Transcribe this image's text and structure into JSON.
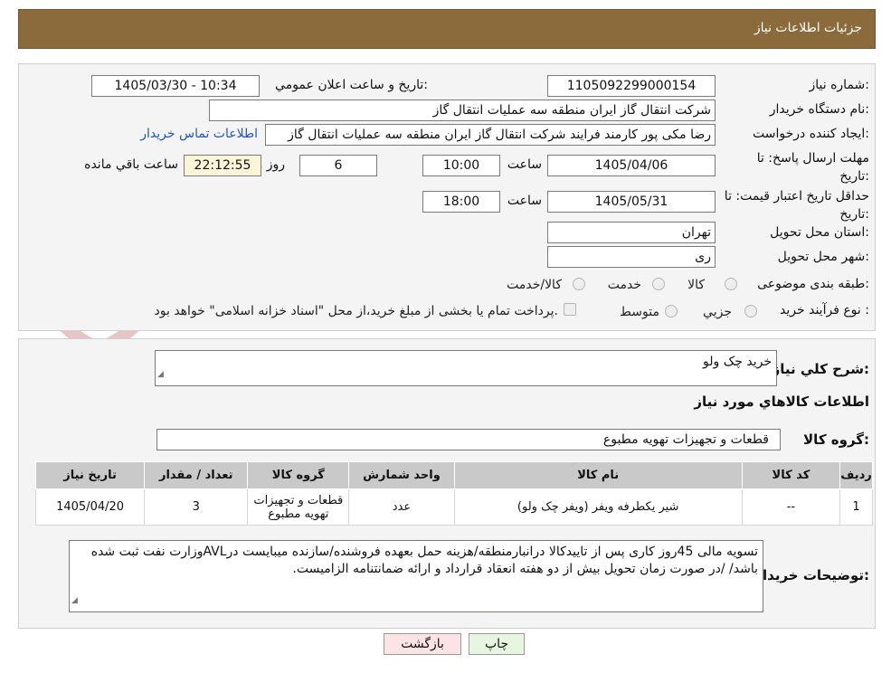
{
  "header": {
    "title": "جزئیات اطلاعات نیاز"
  },
  "watermark": {
    "text": "AriaTender.neT"
  },
  "form": {
    "need_number": {
      "label": "شماره نیاز:",
      "value": "1105092299000154"
    },
    "announce_datetime": {
      "label": "تاریخ و ساعت اعلان عمومي:",
      "value": "1405/03/30 - 10:34"
    },
    "buyer_org": {
      "label": "نام دستگاه خریدار:",
      "value": "شرکت انتقال گاز ایران منطقه سه عملیات انتقال گاز"
    },
    "creator": {
      "label": "ایجاد کننده درخواست:",
      "value": "رضا مکی پور کارمند فرایند شرکت انتقال گاز ایران منطقه سه عملیات انتقال گاز",
      "contact_link": "اطلاعات تماس خریدار"
    },
    "deadline": {
      "label": "مهلت ارسال پاسخ: تا تاریخ:",
      "date": "1405/04/06",
      "time_label": "ساعت",
      "time": "10:00",
      "days": "6",
      "days_label": "روز و",
      "remaining": "22:12:55",
      "remaining_label": "ساعت باقي مانده"
    },
    "price_validity": {
      "label": "حداقل تاریخ اعتبار قیمت: تا تاریخ:",
      "date": "1405/05/31",
      "time_label": "ساعت",
      "time": "18:00"
    },
    "province": {
      "label": "استان محل تحویل:",
      "value": "تهران"
    },
    "city": {
      "label": "شهر محل تحویل:",
      "value": "ری"
    },
    "category": {
      "label": "طبقه بندی موضوعی:",
      "options": [
        "کالا",
        "خدمت",
        "کالا/خدمت"
      ]
    },
    "process": {
      "label": "نوع فرآیند خرید :",
      "options": [
        "جزيي",
        "متوسط"
      ],
      "payment_note": "پرداخت تمام یا بخشی از مبلغ خرید،از محل \"اسناد خزانه اسلامی\" خواهد بود."
    }
  },
  "details": {
    "summary_label": "شرح كلي نياز:",
    "summary_value": "خرید چک ولو",
    "items_title": "اطلاعات كالاهاي مورد نياز",
    "group_label": "گروه كالا:",
    "group_value": "قطعات و تجهیزات تهویه مطبوع",
    "table": {
      "headers": [
        "رديف",
        "کد کالا",
        "نام کالا",
        "واحد شمارش",
        "گروه کالا",
        "تعداد / مقدار",
        "تاریخ نیاز"
      ],
      "rows": [
        [
          "1",
          "--",
          "شیر یکطرفه ویفر (ویفر چک ولو)",
          "عدد",
          "قطعات و تجهیزات تهویه مطبوع",
          "3",
          "1405/04/20"
        ]
      ]
    },
    "buyer_notes_label": "توضیحات خریدار:",
    "buyer_notes_value": "تسویه مالی 45روز کاری پس از تاییدکالا درانبارمنطقه/هزینه حمل بعهده فروشنده/سازنده میبایست درAVLوزارت نفت ثبت شده باشد/ /در صورت زمان تحویل بیش از دو هفته انعقاد قرارداد و ارائه ضمانتنامه الزامیست."
  },
  "buttons": {
    "print": "چاپ",
    "back": "بازگشت"
  },
  "colors": {
    "header_bg": "#8b6a3c",
    "back_button_bg": "#fde4e4",
    "print_button_bg": "#e6f6e0",
    "link": "#2255bb",
    "remaining_bg": "#fbf5d8"
  }
}
